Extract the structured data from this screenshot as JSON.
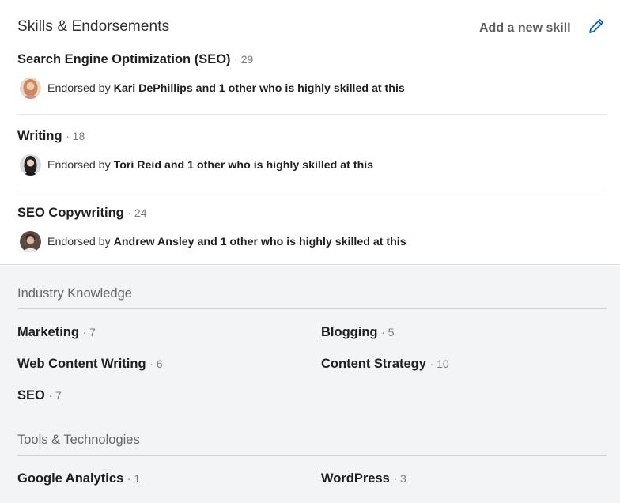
{
  "header": {
    "title": "Skills & Endorsements",
    "add_skill_label": "Add a new skill",
    "accent_color": "#0a66c2"
  },
  "top_skills": [
    {
      "name": "Search Engine Optimization (SEO)",
      "count": "· 29",
      "endorsed_prefix": "Endorsed by ",
      "endorser": "Kari DePhillips and 1 other who is highly skilled at this"
    },
    {
      "name": "Writing",
      "count": "· 18",
      "endorsed_prefix": "Endorsed by ",
      "endorser": "Tori Reid and 1 other who is highly skilled at this"
    },
    {
      "name": "SEO Copywriting",
      "count": "· 24",
      "endorsed_prefix": "Endorsed by ",
      "endorser": "Andrew Ansley and 1 other who is highly skilled at this"
    }
  ],
  "industry_knowledge": {
    "title": "Industry Knowledge",
    "items": [
      {
        "name": "Marketing",
        "count": "· 7"
      },
      {
        "name": "Blogging",
        "count": "· 5"
      },
      {
        "name": "Web Content Writing",
        "count": "· 6"
      },
      {
        "name": "Content Strategy",
        "count": "· 10"
      },
      {
        "name": "SEO",
        "count": "· 7"
      }
    ]
  },
  "tools_technologies": {
    "title": "Tools & Technologies",
    "items": [
      {
        "name": "Google Analytics",
        "count": "· 1"
      },
      {
        "name": "WordPress",
        "count": "· 3"
      }
    ]
  }
}
